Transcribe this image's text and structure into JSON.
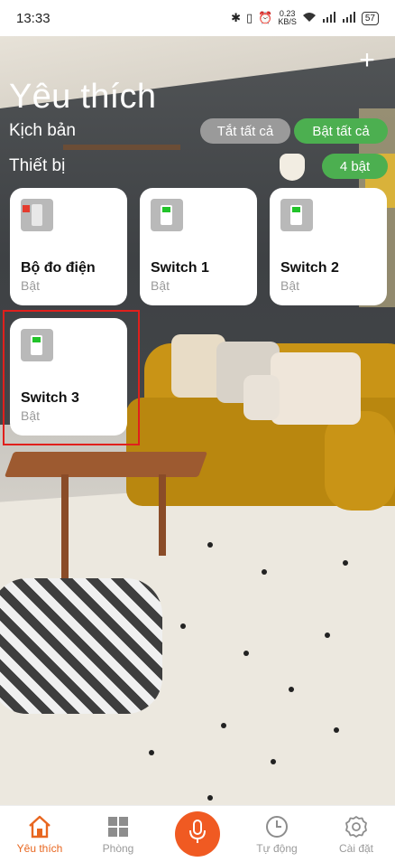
{
  "status_bar": {
    "time": "13:33",
    "net_speed": "0.23",
    "net_unit": "KB/S",
    "battery": "57"
  },
  "header": {
    "title": "Yêu thích",
    "add_icon": "plus-icon"
  },
  "scenes": {
    "label": "Kịch bản",
    "all_off_label": "Tắt tất cả",
    "all_on_label": "Bật tất cả"
  },
  "devices": {
    "label": "Thiết bị",
    "count_badge": "4 bật",
    "items": [
      {
        "name": "Bộ đo điện",
        "state": "Bật",
        "icon": "power-meter-icon"
      },
      {
        "name": "Switch 1",
        "state": "Bật",
        "icon": "switch-icon"
      },
      {
        "name": "Switch 2",
        "state": "Bật",
        "icon": "switch-icon"
      },
      {
        "name": "Switch 3",
        "state": "Bật",
        "icon": "switch-icon"
      }
    ]
  },
  "nav": {
    "items": [
      {
        "label": "Yêu thích",
        "icon": "home-icon",
        "active": true
      },
      {
        "label": "Phòng",
        "icon": "grid-icon",
        "active": false
      },
      {
        "label": "",
        "icon": "mic-icon",
        "active": false
      },
      {
        "label": "Tự động",
        "icon": "clock-icon",
        "active": false
      },
      {
        "label": "Cài đặt",
        "icon": "gear-icon",
        "active": false
      }
    ]
  },
  "colors": {
    "accent": "#f05a22",
    "green": "#4caf50",
    "grey_pill": "#9a9a9a",
    "highlight": "#e0201c"
  }
}
